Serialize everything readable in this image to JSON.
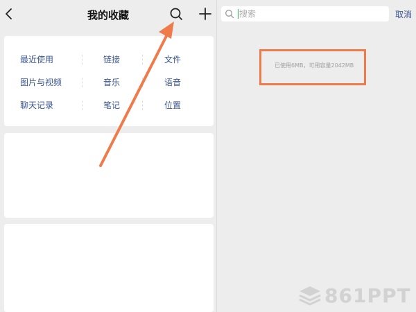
{
  "left_panel": {
    "title": "我的收藏",
    "icons": {
      "back": "chevron-left-icon",
      "search": "search-icon",
      "add": "plus-icon"
    },
    "categories": [
      [
        "最近使用",
        "链接",
        "文件"
      ],
      [
        "图片与视频",
        "音乐",
        "语音"
      ],
      [
        "聊天记录",
        "笔记",
        "位置"
      ]
    ]
  },
  "right_panel": {
    "search": {
      "placeholder": "搜索",
      "value": ""
    },
    "cancel_label": "取消",
    "storage_info": "已使用6MB，可用容量2042MB"
  },
  "annotation": {
    "color": "#ef7a4a"
  },
  "watermark": {
    "text": "861PPT"
  },
  "colors": {
    "link": "#3a5590",
    "background": "#ededed",
    "card": "#ffffff",
    "cursor": "#2bb24c"
  }
}
